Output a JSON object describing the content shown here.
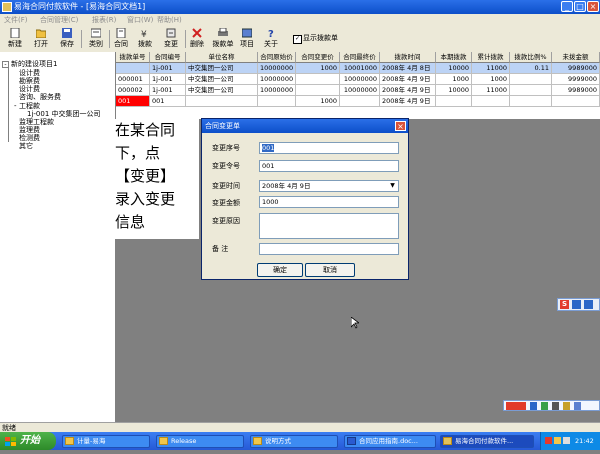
{
  "window": {
    "title": "易海合同付款软件 - [易海合同文档1]"
  },
  "menus": [
    "文件(F)",
    "合同管理(C)",
    "报表(R)",
    "窗口(W)",
    "帮助(H)"
  ],
  "toolbar": {
    "buttons": [
      {
        "label": "新建",
        "icon": "new-icon"
      },
      {
        "label": "打开",
        "icon": "open-folder-icon"
      },
      {
        "label": "保存",
        "icon": "save-icon"
      },
      {
        "label": "类别",
        "icon": "category-icon"
      },
      {
        "label": "合同",
        "icon": "contract-icon"
      },
      {
        "label": "拨款",
        "icon": "funding-icon"
      },
      {
        "label": "变更",
        "icon": "change-icon"
      },
      {
        "label": "删除",
        "icon": "delete-icon"
      },
      {
        "label": "拨款单",
        "icon": "print-icon"
      },
      {
        "label": "项目",
        "icon": "project-icon"
      },
      {
        "label": "关于",
        "icon": "help-icon"
      }
    ],
    "checkbox_label": "显示拨款单",
    "checkbox_checked": true
  },
  "tree": {
    "root": "新的建设项目1",
    "items": [
      "设计费",
      "勘察费",
      "设计费",
      "咨询、服务费"
    ],
    "group": "工程款",
    "group_child": "1j-001 中交集团一公司",
    "group_after": [
      "监理工程款",
      "监理费",
      "检测费",
      "其它"
    ]
  },
  "grid": {
    "columns": [
      "拨款单号",
      "合同编号",
      "单位名称",
      "合同原始价",
      "合同变更价",
      "合同最终价",
      "拨款时间",
      "本期拨款",
      "累计拨款",
      "拨款比例%",
      "未拨金额"
    ],
    "rows": [
      [
        "",
        "1j-001",
        "中交集团一公司",
        "10000000",
        "1000",
        "10001000",
        "2008年 4月 8日",
        "10000",
        "11000",
        "0.11",
        "9989000"
      ],
      [
        "000001",
        "1j-001",
        "中交集团一公司",
        "10000000",
        "",
        "10000000",
        "2008年 4月 9日",
        "1000",
        "1000",
        "",
        "9999000"
      ],
      [
        "000002",
        "1j-001",
        "中交集团一公司",
        "10000000",
        "",
        "10000000",
        "2008年 4月 9日",
        "10000",
        "11000",
        "",
        "9989000"
      ],
      [
        "001",
        "001",
        "",
        "",
        "1000",
        "",
        "2008年 4月 9日",
        "",
        "",
        "",
        ""
      ]
    ]
  },
  "tip": {
    "lines": [
      "在某合同",
      "下，点",
      "【变更】",
      "录入变更",
      "信息"
    ]
  },
  "dialog": {
    "title": "合同变更单",
    "fields": {
      "seq_label": "变更序号",
      "seq_value": "001",
      "order_label": "变更令号",
      "order_value": "001",
      "date_label": "变更时间",
      "date_value": "2008年  4月  9日",
      "amount_label": "变更金额",
      "amount_value": "1000",
      "reason_label": "变更原因",
      "reason_value": "",
      "note_label": "备    注",
      "note_value": ""
    },
    "ok_label": "确定",
    "cancel_label": "取消"
  },
  "status": {
    "text": "就绪"
  },
  "taskbar": {
    "start_label": "开始",
    "tasks": [
      {
        "label": "计量-易海"
      },
      {
        "label": "Release"
      },
      {
        "label": "说明方式"
      },
      {
        "label": "合同应用指南.doc..."
      },
      {
        "label": "易海合同付款软件..."
      }
    ],
    "clock": "21:42"
  },
  "colors": {
    "titlebar": "#0d4fc9",
    "selected_row": "#bcd3f5",
    "new_row_red": "#ff0000",
    "dialog_border": "#0a246a"
  }
}
